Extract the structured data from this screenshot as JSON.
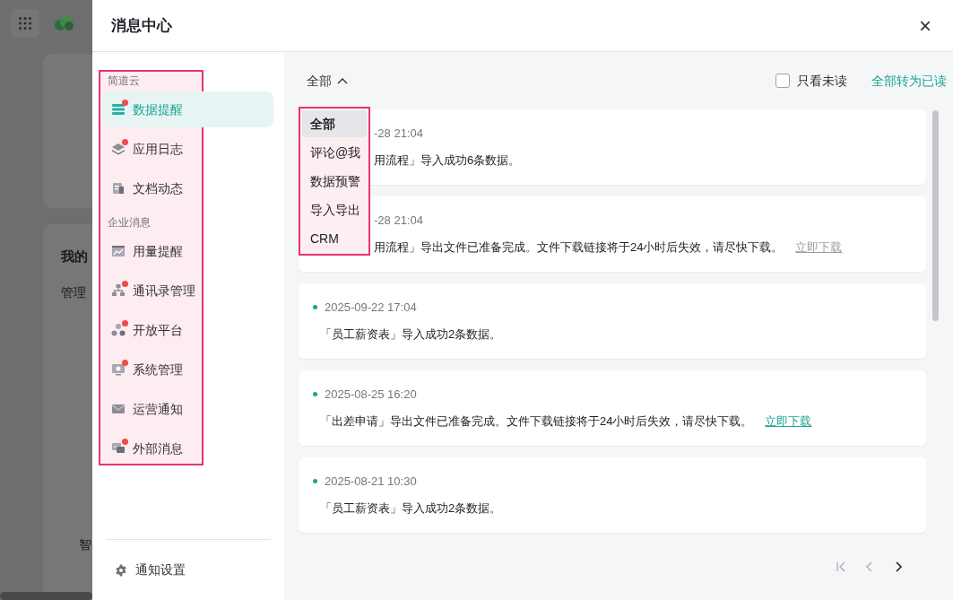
{
  "background": {
    "texts": [
      "我的",
      "管理",
      "智"
    ]
  },
  "drawer": {
    "title": "消息中心",
    "close": "×"
  },
  "sidebar": {
    "groups": [
      {
        "label": "简道云",
        "items": [
          {
            "label": "数据提醒",
            "dot": true,
            "selected": true
          },
          {
            "label": "应用日志",
            "dot": true,
            "selected": false
          },
          {
            "label": "文档动态",
            "dot": false,
            "selected": false
          }
        ]
      },
      {
        "label": "企业消息",
        "items": [
          {
            "label": "用量提醒",
            "dot": false,
            "selected": false
          },
          {
            "label": "通讯录管理",
            "dot": true,
            "selected": false
          },
          {
            "label": "开放平台",
            "dot": true,
            "selected": false
          },
          {
            "label": "系统管理",
            "dot": true,
            "selected": false
          },
          {
            "label": "运营通知",
            "dot": false,
            "selected": false
          },
          {
            "label": "外部消息",
            "dot": true,
            "selected": false
          }
        ]
      }
    ],
    "settings": "通知设置"
  },
  "toolbar": {
    "filter": "全部",
    "unread_only": {
      "label": "只看未读",
      "checked": false
    },
    "mark_all": "全部转为已读"
  },
  "filter_menu": [
    {
      "label": "全部",
      "selected": true
    },
    {
      "label": "评论@我",
      "selected": false
    },
    {
      "label": "数据预警",
      "selected": false
    },
    {
      "label": "导入导出",
      "selected": false
    },
    {
      "label": "CRM",
      "selected": false
    }
  ],
  "messages": [
    {
      "time": "-28 21:04",
      "text": "用流程」导入成功6条数据。",
      "covered": true
    },
    {
      "time": "-28 21:04",
      "text": "用流程」导出文件已准备完成。文件下载链接将于24小时后失效，请尽快下载。",
      "link": "立即下载",
      "visited": true,
      "covered": true
    },
    {
      "time": "2025-09-22 17:04",
      "text": "「员工薪资表」导入成功2条数据。",
      "unread": true,
      "covered": false
    },
    {
      "time": "2025-08-25 16:20",
      "text": "「出差申请」导出文件已准备完成。文件下载链接将于24小时后失效，请尽快下载。",
      "link": "立即下载",
      "visited": false,
      "unread": true,
      "covered": false
    },
    {
      "time": "2025-08-21 10:30",
      "text": "「员工薪资表」导入成功2条数据。",
      "unread": true,
      "covered": false
    }
  ],
  "pagination": {
    "first_disabled": true,
    "prev_disabled": true,
    "next_disabled": false
  }
}
